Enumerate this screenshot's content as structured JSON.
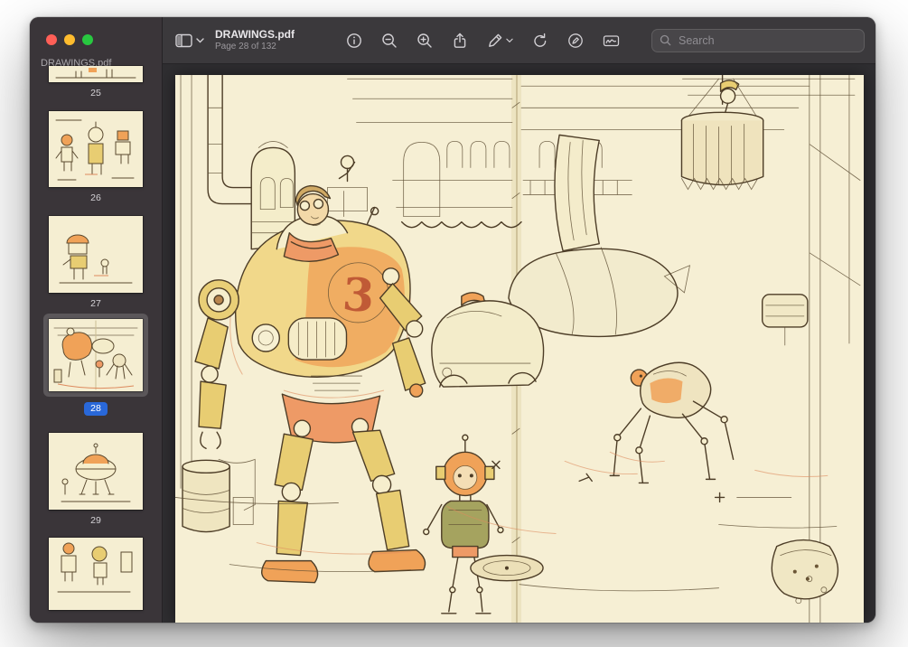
{
  "window": {
    "title": "DRAWINGS.pdf",
    "page_status": "Page 28 of 132"
  },
  "toolbar": {
    "search_placeholder": "Search",
    "icons": [
      "sidebar-toggle",
      "info",
      "zoom-out",
      "zoom-in",
      "share",
      "markup-pen",
      "rotate",
      "annotate",
      "signature",
      "search"
    ]
  },
  "sidebar": {
    "doc_label": "DRAWINGS.pdf",
    "selected_page": "28",
    "pages": [
      {
        "label": "25"
      },
      {
        "label": "26"
      },
      {
        "label": "27"
      },
      {
        "label": "28",
        "selected": true
      },
      {
        "label": "29"
      }
    ]
  },
  "artwork": {
    "robot_number": "3",
    "description": "Ink and watercolor sketchbook spread: large orange piloted robot, small child robot, spider robot, street with car, airship and hanging basket"
  },
  "colors": {
    "accent_blue": "#2968d9",
    "paper_cream": "#f6efd4",
    "wash_orange": "#f0a258",
    "wash_yellow": "#e8cd72",
    "titlebar": "#3b393c",
    "sidebar": "#3a3539",
    "content_bg": "#2f2e31"
  }
}
